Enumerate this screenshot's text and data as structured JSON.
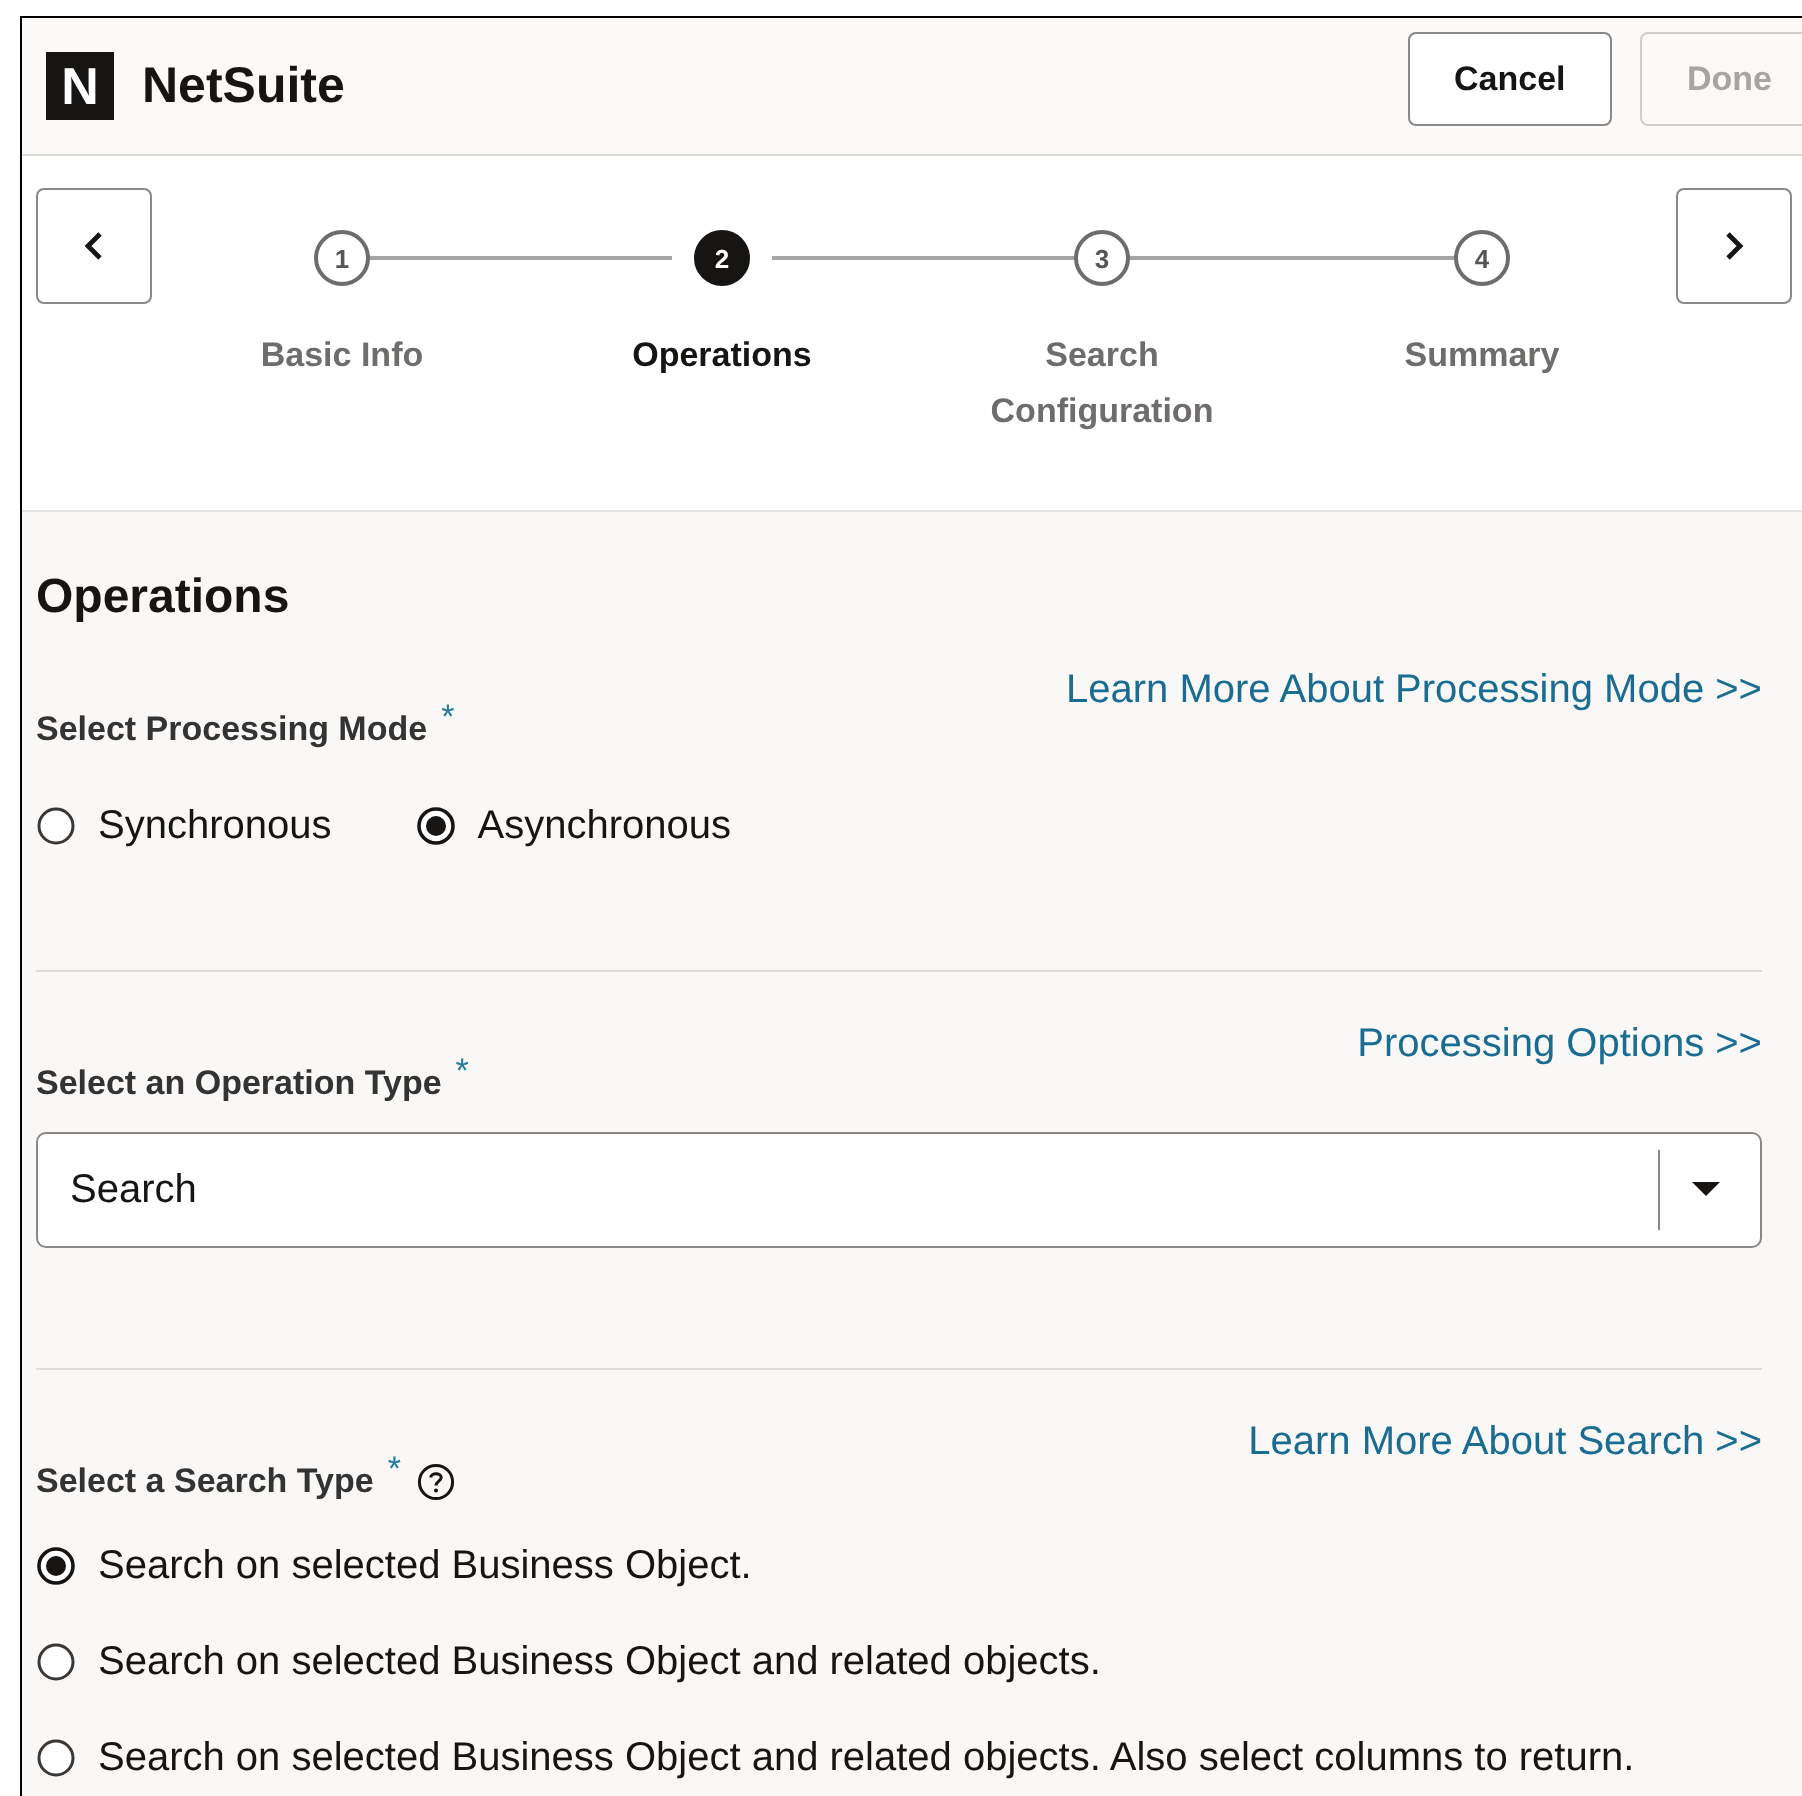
{
  "header": {
    "logo": "N",
    "title": "NetSuite",
    "buttons": [
      {
        "label": "Cancel",
        "disabled": false
      },
      {
        "label": "Done",
        "disabled": true
      }
    ]
  },
  "stepper": {
    "steps": [
      {
        "number": "1",
        "label": "Basic Info",
        "selected": false
      },
      {
        "number": "2",
        "label": "Operations",
        "selected": true
      },
      {
        "number": "3",
        "label": "Search Configuration",
        "selected": false
      },
      {
        "number": "4",
        "label": "Summary",
        "selected": false
      }
    ]
  },
  "page_title": "Operations",
  "sections": [
    {
      "label": "Select Processing Mode",
      "required_mark": "*",
      "help": false,
      "link": "Learn More About Processing Mode >>",
      "kind": "radio_row",
      "options": [
        {
          "label": "Synchronous",
          "selected": false
        },
        {
          "label": "Asynchronous",
          "selected": true
        }
      ]
    },
    {
      "kind": "select",
      "label": "Select an Operation Type",
      "required_mark": "*",
      "help": false,
      "link": "Processing Options >>",
      "value": "Search"
    },
    {
      "label": "Select a Search Type",
      "required_mark": "*",
      "help": true,
      "link": "Learn More About Search >>",
      "kind": "radio_column",
      "options": [
        {
          "label": "Search on selected Business Object.",
          "selected": true
        },
        {
          "label": "Search on selected Business Object and related objects.",
          "selected": false
        },
        {
          "label": "Search on selected Business Object and related objects. Also select columns to return.",
          "selected": false
        }
      ]
    }
  ]
}
